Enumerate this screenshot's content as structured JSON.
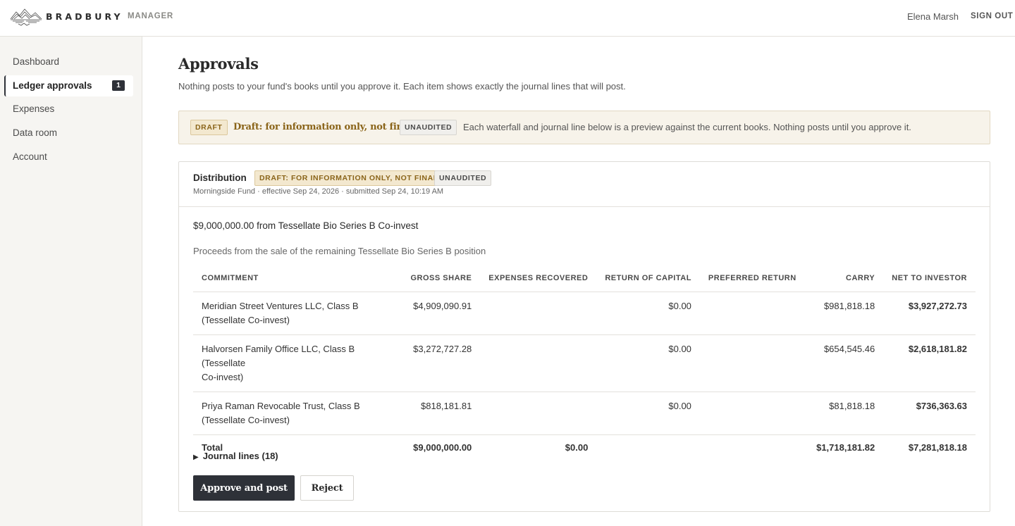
{
  "header": {
    "brand": "BRADBURY",
    "brand_sub": "MANAGER",
    "user_name": "Elena Marsh",
    "sign_out": "SIGN OUT",
    "logo_icon": "mountain-landscape-logo"
  },
  "sidebar": {
    "items": [
      {
        "label": "Dashboard",
        "active": false
      },
      {
        "label": "Ledger approvals",
        "active": true,
        "badge": "1"
      },
      {
        "label": "Expenses",
        "active": false
      },
      {
        "label": "Data room",
        "active": false
      },
      {
        "label": "Account",
        "active": false
      }
    ]
  },
  "main": {
    "title": "Approvals",
    "description": "Nothing posts to your fund's books until you approve it. Each item shows exactly the journal lines that will post.",
    "banner": {
      "tag_draft": "DRAFT",
      "strong": "Draft: for information only, not final.",
      "tag_unaudited": "UNAUDITED",
      "text": "Each waterfall and journal line below is a preview against the current books. Nothing posts until you approve it."
    },
    "card": {
      "title": "Distribution",
      "tag_draft": "DRAFT: FOR INFORMATION ONLY, NOT FINAL",
      "tag_unaudited": "UNAUDITED",
      "meta": "Morningside Fund · effective Sep 24, 2026 · submitted Sep 24, 10:19 AM",
      "amount_line": "$9,000,000.00 from Tessellate Bio Series B Co-invest",
      "description": "Proceeds from the sale of the remaining Tessellate Bio Series B position",
      "columns": [
        "COMMITMENT",
        "GROSS SHARE",
        "EXPENSES RECOVERED",
        "RETURN OF CAPITAL",
        "PREFERRED RETURN",
        "CARRY",
        "NET TO INVESTOR"
      ],
      "rows": [
        {
          "commitment_1": "Meridian Street Ventures LLC, Class B",
          "commitment_2": "(Tessellate Co-invest)",
          "gross_share": "$4,909,090.91",
          "expenses_recovered": "",
          "return_of_capital": "$0.00",
          "preferred_return": "",
          "carry": "$981,818.18",
          "net_to_investor": "$3,927,272.73"
        },
        {
          "commitment_1": "Halvorsen Family Office LLC, Class B (Tessellate",
          "commitment_2": "Co-invest)",
          "gross_share": "$3,272,727.28",
          "expenses_recovered": "",
          "return_of_capital": "$0.00",
          "preferred_return": "",
          "carry": "$654,545.46",
          "net_to_investor": "$2,618,181.82"
        },
        {
          "commitment_1": "Priya Raman Revocable Trust, Class B",
          "commitment_2": "(Tessellate Co-invest)",
          "gross_share": "$818,181.81",
          "expenses_recovered": "",
          "return_of_capital": "$0.00",
          "preferred_return": "",
          "carry": "$81,818.18",
          "net_to_investor": "$736,363.63"
        }
      ],
      "total": {
        "label": "Total",
        "gross_share": "$9,000,000.00",
        "expenses_recovered": "$0.00",
        "return_of_capital": "",
        "preferred_return": "",
        "carry": "$1,718,181.82",
        "net_to_investor": "$7,281,818.18"
      },
      "journal_toggle": "Journal lines (18)",
      "approve_label": "Approve and post",
      "reject_label": "Reject"
    }
  }
}
